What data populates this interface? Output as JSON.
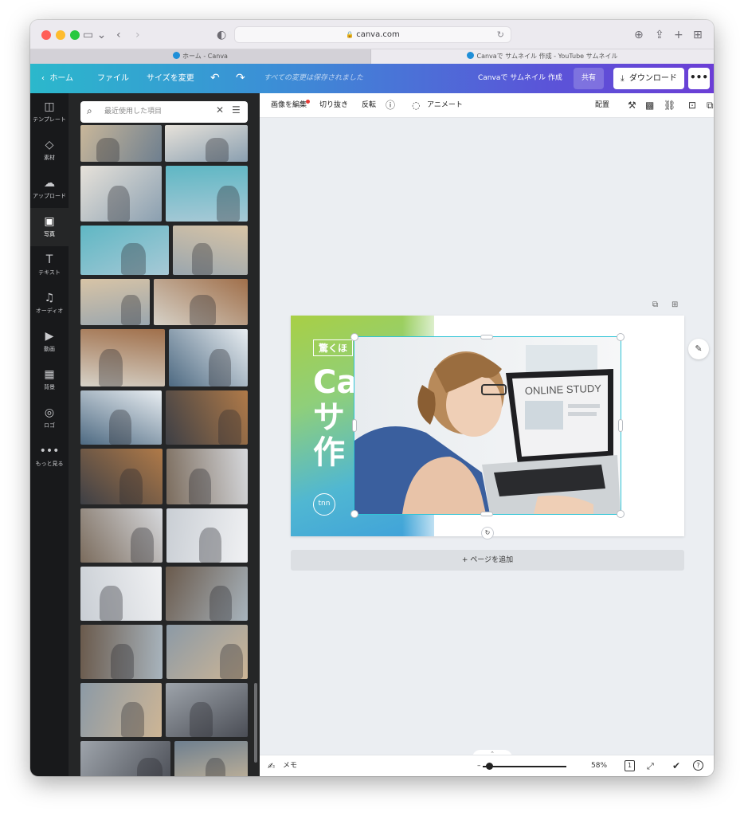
{
  "browser": {
    "url": "canva.com",
    "tabs": [
      {
        "label": "ホーム - Canva"
      },
      {
        "label": "Canvaで サムネイル 作成 - YouTube サムネイル"
      }
    ]
  },
  "header": {
    "home": "ホーム",
    "file": "ファイル",
    "resize": "サイズを変更",
    "saved": "すべての変更は保存されました",
    "doc_title": "Canvaで サムネイル 作成",
    "share": "共有",
    "download": "ダウンロード",
    "more": "•••"
  },
  "rail": {
    "items": [
      {
        "label": "テンプレート",
        "icon": "template-icon",
        "glyph": "◫"
      },
      {
        "label": "素材",
        "icon": "elements-icon",
        "glyph": "◇"
      },
      {
        "label": "アップロード",
        "icon": "upload-icon",
        "glyph": "☁"
      },
      {
        "label": "写真",
        "icon": "photo-icon",
        "glyph": "▣"
      },
      {
        "label": "テキスト",
        "icon": "text-icon",
        "glyph": "T"
      },
      {
        "label": "オーディオ",
        "icon": "audio-icon",
        "glyph": "♫"
      },
      {
        "label": "動画",
        "icon": "video-icon",
        "glyph": "▶"
      },
      {
        "label": "背景",
        "icon": "background-icon",
        "glyph": "▦"
      },
      {
        "label": "ロゴ",
        "icon": "logo-icon",
        "glyph": "◎"
      },
      {
        "label": "もっと見る",
        "icon": "more-icon",
        "glyph": "•••"
      }
    ]
  },
  "panel": {
    "search_placeholder": "最近使用した項目"
  },
  "toolbar": {
    "edit_image": "画像を編集",
    "crop": "切り抜き",
    "flip": "反転",
    "animate": "アニメート",
    "position": "配置"
  },
  "design": {
    "tag": "驚くほ",
    "line1": "Ca",
    "line2": "サ",
    "line3": "作",
    "logo": "tnn",
    "photo_caption": "ONLINE STUDY"
  },
  "canvas": {
    "add_page": "+ ページを追加"
  },
  "footer": {
    "notes": "メモ",
    "zoom": "58%",
    "page_count": "1",
    "help": "?"
  },
  "colors": {
    "header_start": "#2bb8cc",
    "header_end": "#6b3ed6",
    "selection": "#2ec4d6",
    "rail_bg": "#18191b",
    "panel_bg": "#252627"
  }
}
